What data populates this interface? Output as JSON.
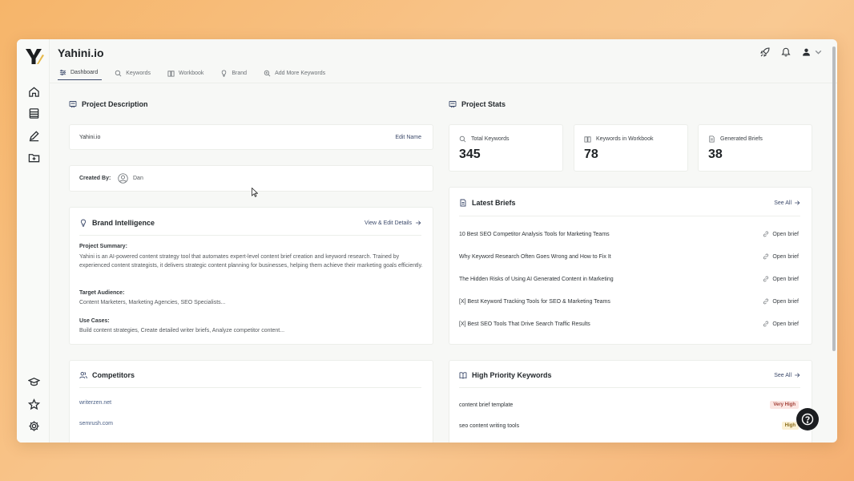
{
  "app": {
    "title": "Yahini.io"
  },
  "tabs": [
    {
      "label": "Dashboard",
      "icon": "sliders-icon"
    },
    {
      "label": "Keywords",
      "icon": "search-icon"
    },
    {
      "label": "Workbook",
      "icon": "book-icon"
    },
    {
      "label": "Brand",
      "icon": "lightbulb-icon"
    },
    {
      "label": "Add More Keywords",
      "icon": "search-plus-icon"
    }
  ],
  "project_description": {
    "title": "Project Description",
    "name": "Yahini.io",
    "edit_label": "Edit Name",
    "created_by_label": "Created By:",
    "created_by_user": "Dan"
  },
  "brand": {
    "title": "Brand Intelligence",
    "view_edit_label": "View & Edit Details",
    "summary_label": "Project Summary:",
    "summary_text": "Yahini is an AI-powered content strategy tool that automates expert-level content brief creation and keyword research. Trained by experienced content strategists, it delivers strategic content planning for businesses, helping them achieve their marketing goals efficiently.",
    "audience_label": "Target Audience:",
    "audience_text": "Content Marketers, Marketing Agencies, SEO Specialists...",
    "usecases_label": "Use Cases:",
    "usecases_text": "Build content strategies, Create detailed writer briefs, Analyze competitor content..."
  },
  "competitors": {
    "title": "Competitors",
    "items": [
      "writerzen.net",
      "semrush.com"
    ]
  },
  "stats": {
    "title": "Project Stats",
    "items": [
      {
        "label": "Total Keywords",
        "value": "345",
        "icon": "search-icon"
      },
      {
        "label": "Keywords in Workbook",
        "value": "78",
        "icon": "book-icon"
      },
      {
        "label": "Generated Briefs",
        "value": "38",
        "icon": "document-icon"
      }
    ]
  },
  "latest_briefs": {
    "title": "Latest Briefs",
    "see_all": "See All",
    "open_label": "Open brief",
    "items": [
      "10 Best SEO Competitor Analysis Tools for Marketing Teams",
      "Why Keyword Research Often Goes Wrong and How to Fix It",
      "The Hidden Risks of Using AI Generated Content in Marketing",
      "[X] Best Keyword Tracking Tools for SEO & Marketing Teams",
      "[X] Best SEO Tools That Drive Search Traffic Results"
    ]
  },
  "high_priority": {
    "title": "High Priority Keywords",
    "see_all": "See All",
    "items": [
      {
        "keyword": "content brief template",
        "priority": "Very High"
      },
      {
        "keyword": "seo content writing tools",
        "priority": "High"
      }
    ]
  },
  "colors": {
    "accent": "#3c4a6b",
    "very_high_bg": "#fbe6e3",
    "very_high_text": "#a4433a",
    "high_bg": "#fbf1d6",
    "high_text": "#8a6b18"
  }
}
